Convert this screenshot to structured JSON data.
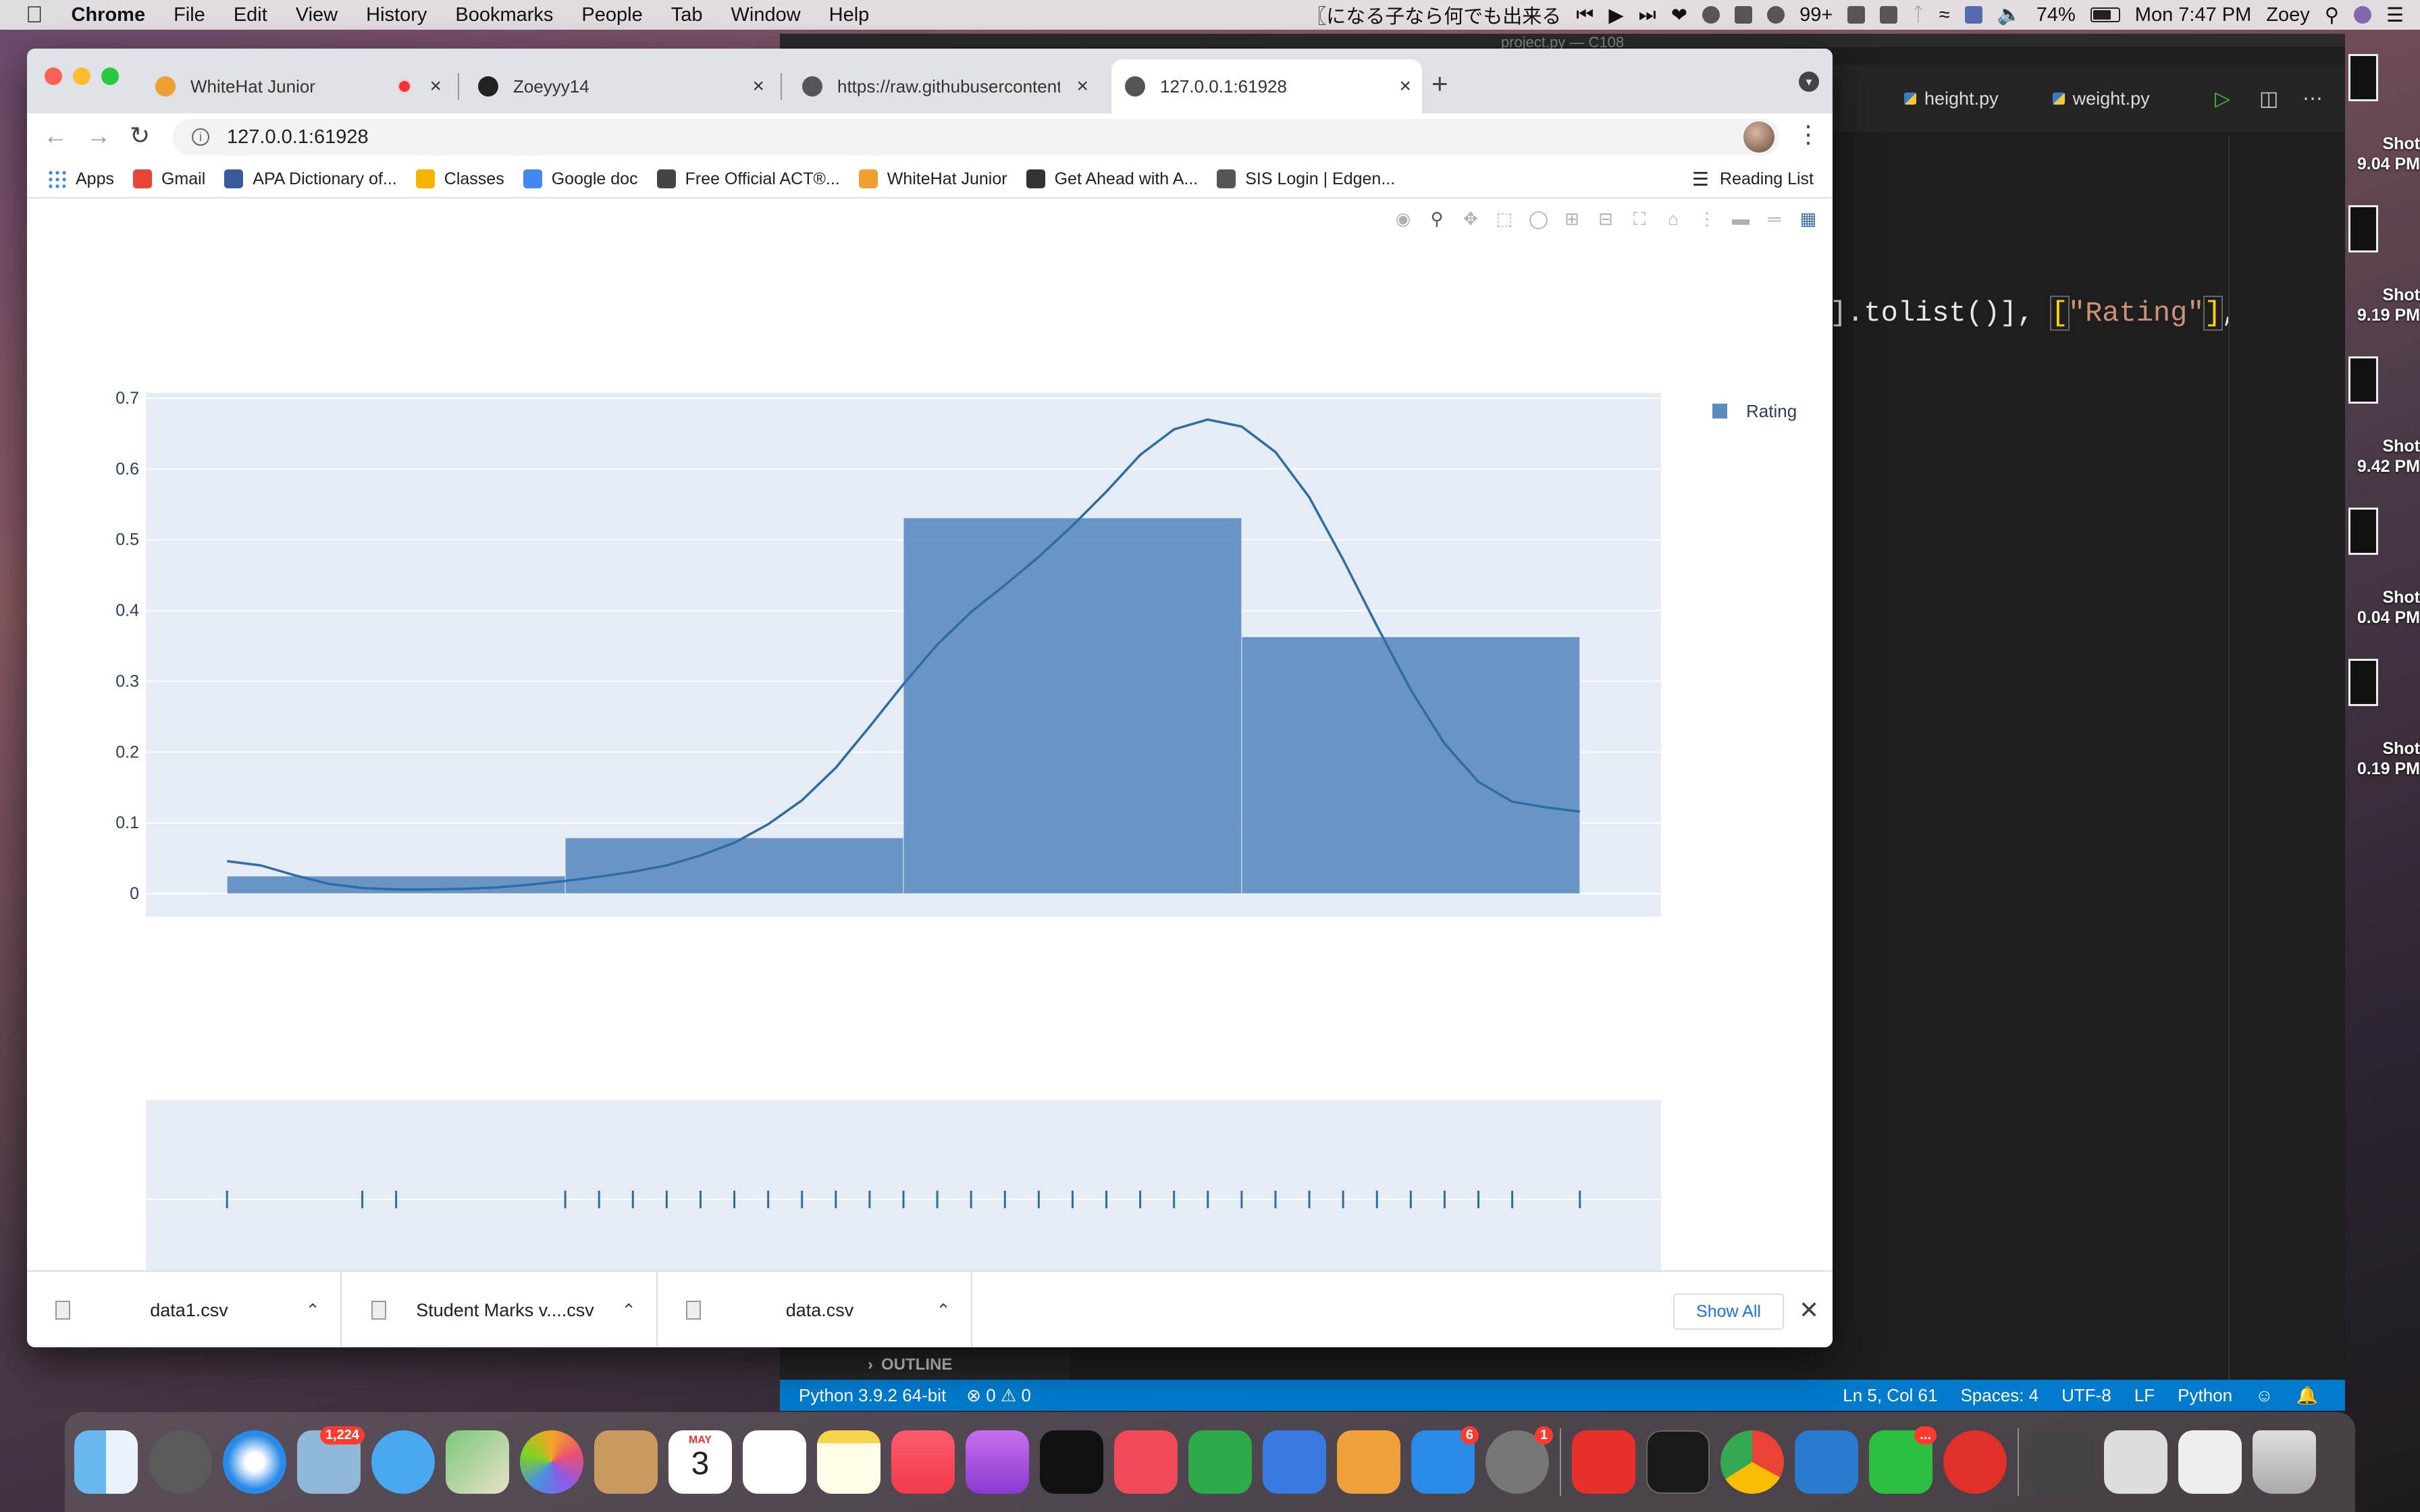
{
  "menubar": {
    "app_name": "Chrome",
    "items": [
      "File",
      "Edit",
      "View",
      "History",
      "Bookmarks",
      "People",
      "Tab",
      "Window",
      "Help"
    ],
    "now_playing": "〖になる子なら何でも出来る",
    "notifications_count": "99+",
    "battery": "74%",
    "battery_level": 0.74,
    "clock": "Mon 7:47 PM",
    "user": "Zoey"
  },
  "browser": {
    "tabs": [
      {
        "title": "WhiteHat Junior",
        "fav": "#f0a030",
        "recording": true
      },
      {
        "title": "Zoeyyy14",
        "fav": "#222222"
      },
      {
        "title": "https://raw.githubusercontent...",
        "fav": "#555555"
      },
      {
        "title": "127.0.0.1:61928",
        "fav": "#555555",
        "active": true
      }
    ],
    "url": "127.0.0.1:61928",
    "bookmarks": [
      {
        "label": "Apps",
        "color": "#4285f4"
      },
      {
        "label": "Gmail",
        "color": "#ea4335"
      },
      {
        "label": "APA Dictionary of...",
        "color": "#3a5a9a"
      },
      {
        "label": "Classes",
        "color": "#f4b400"
      },
      {
        "label": "Google doc",
        "color": "#4285f4"
      },
      {
        "label": "Free Official ACT®...",
        "color": "#444444"
      },
      {
        "label": "WhiteHat Junior",
        "color": "#f0a030"
      },
      {
        "label": "Get Ahead with A...",
        "color": "#333333"
      },
      {
        "label": "SIS Login | Edgen...",
        "color": "#555555"
      }
    ],
    "reading_list": "Reading List",
    "downloads": [
      {
        "name": "data1.csv"
      },
      {
        "name": "Student Marks v....csv"
      },
      {
        "name": "data.csv"
      }
    ],
    "show_all": "Show All"
  },
  "chart_data": {
    "type": "histogram",
    "legend": [
      "Rating"
    ],
    "legend_position": "top-right",
    "bar_color": "#5b8cc0",
    "line_color": "#2e6ca5",
    "xlim": [
      1,
      5
    ],
    "ylim": [
      0,
      0.7
    ],
    "x_ticks": [
      "1",
      "1.5",
      "2",
      "2.5",
      "3",
      "3.5",
      "4",
      "4.5",
      "5"
    ],
    "y_ticks": [
      "0",
      "0.1",
      "0.2",
      "0.3",
      "0.4",
      "0.5",
      "0.6",
      "0.7"
    ],
    "bins": [
      {
        "x0": 1,
        "x1": 2,
        "value": 0.025
      },
      {
        "x0": 2,
        "x1": 3,
        "value": 0.079
      },
      {
        "x0": 3,
        "x1": 4,
        "value": 0.531
      },
      {
        "x0": 4,
        "x1": 5,
        "value": 0.363
      }
    ],
    "kde": [
      [
        1.0,
        0.046
      ],
      [
        1.1,
        0.04
      ],
      [
        1.2,
        0.026
      ],
      [
        1.3,
        0.014
      ],
      [
        1.4,
        0.008
      ],
      [
        1.5,
        0.006
      ],
      [
        1.6,
        0.006
      ],
      [
        1.7,
        0.007
      ],
      [
        1.8,
        0.009
      ],
      [
        1.9,
        0.013
      ],
      [
        2.0,
        0.018
      ],
      [
        2.1,
        0.024
      ],
      [
        2.2,
        0.031
      ],
      [
        2.3,
        0.04
      ],
      [
        2.4,
        0.054
      ],
      [
        2.5,
        0.072
      ],
      [
        2.6,
        0.098
      ],
      [
        2.7,
        0.132
      ],
      [
        2.8,
        0.178
      ],
      [
        2.9,
        0.236
      ],
      [
        3.0,
        0.296
      ],
      [
        3.1,
        0.352
      ],
      [
        3.2,
        0.398
      ],
      [
        3.3,
        0.436
      ],
      [
        3.4,
        0.476
      ],
      [
        3.5,
        0.52
      ],
      [
        3.6,
        0.568
      ],
      [
        3.7,
        0.62
      ],
      [
        3.8,
        0.656
      ],
      [
        3.9,
        0.67
      ],
      [
        4.0,
        0.66
      ],
      [
        4.1,
        0.624
      ],
      [
        4.2,
        0.56
      ],
      [
        4.3,
        0.472
      ],
      [
        4.4,
        0.378
      ],
      [
        4.5,
        0.288
      ],
      [
        4.6,
        0.212
      ],
      [
        4.7,
        0.158
      ],
      [
        4.8,
        0.13
      ],
      [
        4.9,
        0.122
      ],
      [
        5.0,
        0.116
      ]
    ],
    "rug_x": [
      1,
      1.4,
      1.5,
      2,
      2.1,
      2.2,
      2.3,
      2.4,
      2.5,
      2.6,
      2.7,
      2.8,
      2.9,
      3,
      3.1,
      3.2,
      3.3,
      3.4,
      3.5,
      3.6,
      3.7,
      3.8,
      3.9,
      4,
      4.1,
      4.2,
      4.3,
      4.4,
      4.5,
      4.6,
      4.7,
      4.8,
      5
    ]
  },
  "vscode": {
    "window_title": "project.py — C108",
    "tabs": [
      "height.py",
      "weight.py"
    ],
    "code_prefix": "].tolist()], ",
    "code_open": "[",
    "code_string": "\"Rating\"",
    "code_close": "]",
    "code_suffix": ",",
    "outline_label": "OUTLINE",
    "status_left": [
      "Python 3.9.2 64-bit",
      "⊗ 0 ⚠ 0"
    ],
    "status_right": [
      "Ln 5, Col 61",
      "Spaces: 4",
      "UTF-8",
      "LF",
      "Python"
    ]
  },
  "desktop": {
    "screenshots": [
      "Shot\n9.04 PM",
      "Shot\n9.19 PM",
      "Shot\n9.42 PM",
      "Shot\n0.04 PM",
      "Shot\n0.19 PM"
    ]
  },
  "dock": {
    "mail_badge": "1,224",
    "appstore_badge": "6",
    "prefs_badge": "1",
    "calendar_month": "MAY",
    "calendar_day": "3",
    "wechat_badge": "..."
  }
}
